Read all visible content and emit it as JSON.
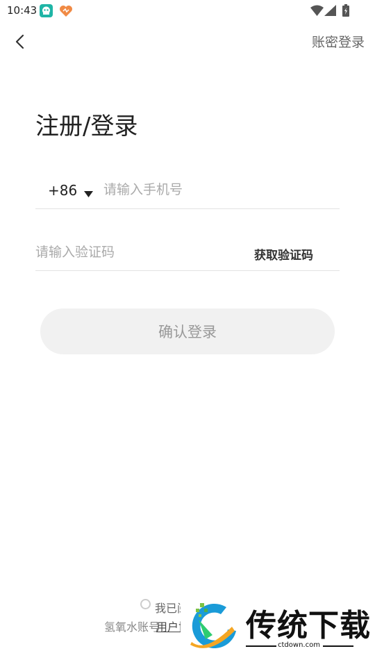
{
  "status_bar": {
    "time": "10:43"
  },
  "header": {
    "password_login": "账密登录"
  },
  "page": {
    "title": "注册/登录"
  },
  "phone": {
    "country_code": "+86",
    "placeholder": "请输入手机号",
    "value": ""
  },
  "code": {
    "placeholder": "请输入验证码",
    "value": "",
    "get_code_label": "获取验证码"
  },
  "confirm": {
    "label": "确认登录"
  },
  "agreement": {
    "prefix": "我已阅",
    "account_text": "氢氧水账号",
    "link_text": "用户协"
  },
  "watermark": {
    "name": "传统下载",
    "url": "ctdown.com"
  },
  "colors": {
    "button_bg": "#f1f1f1",
    "divider": "#e2e2e2",
    "placeholder": "#aaaaaa"
  }
}
